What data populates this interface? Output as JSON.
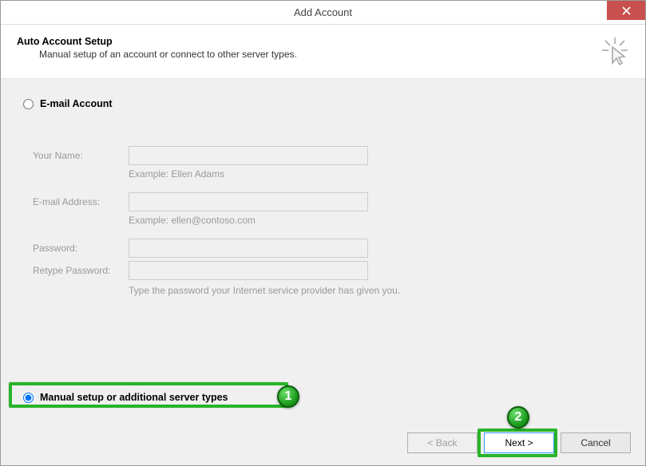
{
  "window": {
    "title": "Add Account"
  },
  "header": {
    "title": "Auto Account Setup",
    "subtitle": "Manual setup of an account or connect to other server types."
  },
  "options": {
    "email_account": "E-mail Account",
    "manual_setup": "Manual setup or additional server types"
  },
  "form": {
    "name_label": "Your Name:",
    "name_example": "Example: Ellen Adams",
    "email_label": "E-mail Address:",
    "email_example": "Example: ellen@contoso.com",
    "password_label": "Password:",
    "retype_label": "Retype Password:",
    "password_hint": "Type the password your Internet service provider has given you."
  },
  "buttons": {
    "back": "< Back",
    "next": "Next >",
    "cancel": "Cancel"
  },
  "annotations": {
    "step1": "1",
    "step2": "2"
  },
  "state": {
    "selected_option": "manual"
  }
}
